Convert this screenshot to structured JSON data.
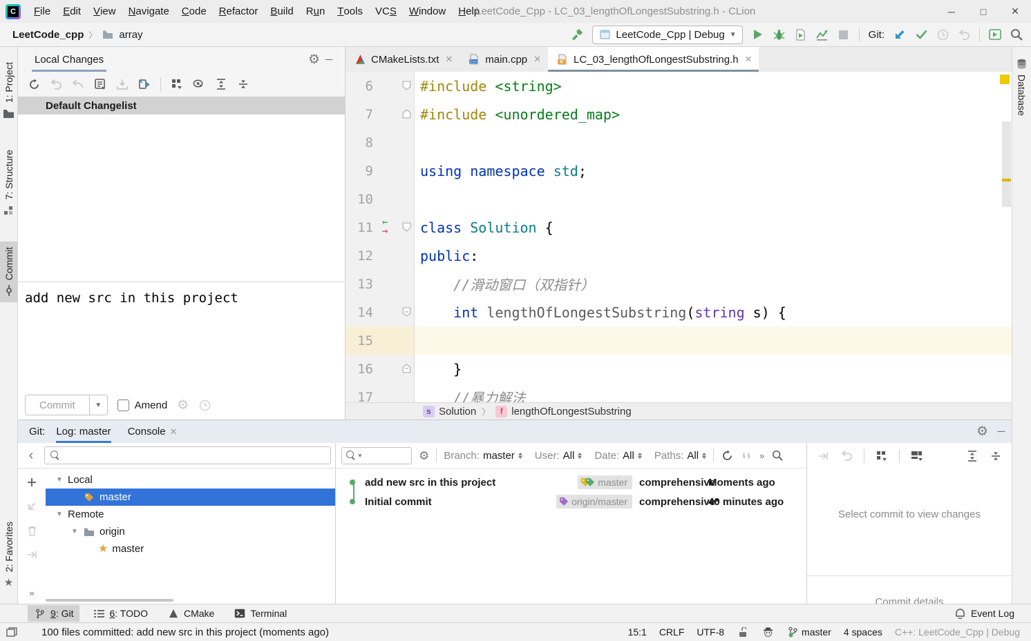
{
  "window": {
    "title": "LeetCode_Cpp - LC_03_lengthOfLongestSubstring.h - CLion",
    "controls": {
      "minimize": "─",
      "maximize": "□",
      "close": "✕"
    }
  },
  "menu": {
    "items": [
      {
        "label": "File",
        "m": 0
      },
      {
        "label": "Edit",
        "m": 0
      },
      {
        "label": "View",
        "m": 0
      },
      {
        "label": "Navigate",
        "m": 0
      },
      {
        "label": "Code",
        "m": 0
      },
      {
        "label": "Refactor",
        "m": 0
      },
      {
        "label": "Build",
        "m": 0
      },
      {
        "label": "Run",
        "m": 1
      },
      {
        "label": "Tools",
        "m": 0
      },
      {
        "label": "VCS",
        "m": 2
      },
      {
        "label": "Window",
        "m": 0
      },
      {
        "label": "Help",
        "m": 0
      }
    ]
  },
  "toolbar": {
    "project": "LeetCode_cpp",
    "folder": "array",
    "run_config": "LeetCode_Cpp | Debug",
    "git_label": "Git:"
  },
  "left_stripe": {
    "top": [
      {
        "icon": "folder-icon",
        "label": "1: Project",
        "m": 0,
        "active": false
      },
      {
        "icon": "structure-icon",
        "label": "7: Structure",
        "m": 0,
        "active": false
      },
      {
        "icon": "commit-icon",
        "label": "Commit",
        "m": -1,
        "active": true
      }
    ],
    "bottom": [
      {
        "icon": "star-icon",
        "label": "2: Favorites",
        "m": 0,
        "active": false
      }
    ]
  },
  "right_stripe": {
    "items": [
      {
        "icon": "database-icon",
        "label": "Database"
      }
    ]
  },
  "commit_panel": {
    "tab": "Local Changes",
    "changelist": "Default Changelist",
    "message": "add new src in this project",
    "commit_button": "Commit",
    "amend_label": "Amend"
  },
  "editor": {
    "tabs": [
      {
        "icon": "cmake",
        "label": "CMakeLists.txt",
        "active": false
      },
      {
        "icon": "cpp",
        "label": "main.cpp",
        "active": false
      },
      {
        "icon": "header",
        "label": "LC_03_lengthOfLongestSubstring.h",
        "active": true
      }
    ],
    "lines": [
      {
        "n": "6",
        "fold": "down",
        "segs": [
          [
            "pp",
            "#include"
          ],
          [
            "pl",
            " "
          ],
          [
            "inc",
            "<string>"
          ]
        ]
      },
      {
        "n": "7",
        "fold": "up",
        "segs": [
          [
            "pp",
            "#include"
          ],
          [
            "pl",
            " "
          ],
          [
            "inc",
            "<unordered_map>"
          ]
        ]
      },
      {
        "n": "8",
        "segs": []
      },
      {
        "n": "9",
        "segs": [
          [
            "kw",
            "using"
          ],
          [
            "pl",
            " "
          ],
          [
            "kw",
            "namespace"
          ],
          [
            "pl",
            " "
          ],
          [
            "cls",
            "std"
          ],
          [
            "pl",
            ";"
          ]
        ]
      },
      {
        "n": "10",
        "segs": []
      },
      {
        "n": "11",
        "fold": "down",
        "arrows": true,
        "segs": [
          [
            "kw",
            "class"
          ],
          [
            "pl",
            " "
          ],
          [
            "cls",
            "Solution"
          ],
          [
            "pl",
            " {"
          ]
        ]
      },
      {
        "n": "12",
        "segs": [
          [
            "kw",
            "public"
          ],
          [
            "pl",
            ":"
          ]
        ]
      },
      {
        "n": "13",
        "segs": [
          [
            "pl",
            "    "
          ],
          [
            "cmt",
            "//滑动窗口（双指针）"
          ]
        ]
      },
      {
        "n": "14",
        "fold": "down-minus",
        "segs": [
          [
            "pl",
            "    "
          ],
          [
            "kw",
            "int"
          ],
          [
            "pl",
            " "
          ],
          [
            "fn",
            "lengthOfLongestSubstring"
          ],
          [
            "pl",
            "("
          ],
          [
            "ty",
            "string"
          ],
          [
            "pl",
            " s) {"
          ]
        ]
      },
      {
        "n": "15",
        "current": true,
        "segs": []
      },
      {
        "n": "16",
        "fold": "up-minus",
        "segs": [
          [
            "pl",
            "    }"
          ]
        ]
      },
      {
        "n": "17",
        "segs": [
          [
            "pl",
            "    "
          ],
          [
            "cmt",
            "//暴力解法"
          ]
        ]
      }
    ],
    "breadcrumbs": [
      {
        "badge": "s",
        "cls": "bc-s",
        "label": "Solution"
      },
      {
        "badge": "f",
        "cls": "bc-f",
        "label": "lengthOfLongestSubstring"
      }
    ]
  },
  "git_panel": {
    "label": "Git:",
    "tabs": [
      {
        "label": "Log: master",
        "active": true,
        "closable": false
      },
      {
        "label": "Console",
        "active": false,
        "closable": true
      }
    ],
    "branch_rows": [
      {
        "indent": 0,
        "twisty": true,
        "icon": null,
        "label": "Local",
        "selected": false
      },
      {
        "indent": 1,
        "twisty": false,
        "icon": "tag-yellow",
        "label": "master",
        "selected": true
      },
      {
        "indent": 0,
        "twisty": true,
        "icon": null,
        "label": "Remote",
        "selected": false
      },
      {
        "indent": 1,
        "twisty": true,
        "icon": "folder",
        "label": "origin",
        "selected": false
      },
      {
        "indent": 2,
        "twisty": false,
        "icon": "star",
        "label": "master",
        "selected": false
      }
    ],
    "filters": [
      {
        "label": "Branch:",
        "value": "master"
      },
      {
        "label": "User:",
        "value": "All"
      },
      {
        "label": "Date:",
        "value": "All"
      },
      {
        "label": "Paths:",
        "value": "All"
      }
    ],
    "commits": [
      {
        "message": "add new src in this project",
        "ref_label": "master",
        "ref_tags": [
          "#E8B711",
          "#59A869"
        ],
        "author": "comprehensive",
        "time": "Moments ago"
      },
      {
        "message": "Initial commit",
        "ref_label": "origin/master",
        "ref_tags": [
          "#A36BC8"
        ],
        "author": "comprehensive*",
        "time": "40 minutes ago"
      }
    ],
    "details_placeholder": "Select commit to view changes",
    "details_title": "Commit details"
  },
  "toolwindow_bar": {
    "items": [
      {
        "icon": "git-branch-icon",
        "label": "9: Git",
        "m": 0,
        "active": true
      },
      {
        "icon": "todo-icon",
        "label": "6: TODO",
        "m": 0,
        "active": false
      },
      {
        "icon": "cmake-icon",
        "label": "CMake",
        "m": -1,
        "active": false
      },
      {
        "icon": "terminal-icon",
        "label": "Terminal",
        "m": -1,
        "active": false
      }
    ],
    "event_log": "Event Log"
  },
  "status_bar": {
    "message": "100 files committed: add new src in this project (moments ago)",
    "position": "15:1",
    "line_ending": "CRLF",
    "encoding": "UTF-8",
    "branch": "master",
    "indent": "4 spaces",
    "config": "C++: LeetCode_Cpp | Debug"
  },
  "icons": {
    "gear": "⚙",
    "chevron-left": "‹",
    "chevrons-right": "»",
    "dropdown": "▾",
    "minimize": "─",
    "close-tab": "✕",
    "star": "★",
    "play": "▶",
    "stop": "■"
  },
  "colors": {
    "accent_blue": "#3273D9",
    "run_green": "#59A869",
    "error_red": "#DB5860",
    "yellow_mark": "#EDC90F",
    "selection": "#3273D9",
    "tab_underline_blue": "#3B77D8"
  }
}
